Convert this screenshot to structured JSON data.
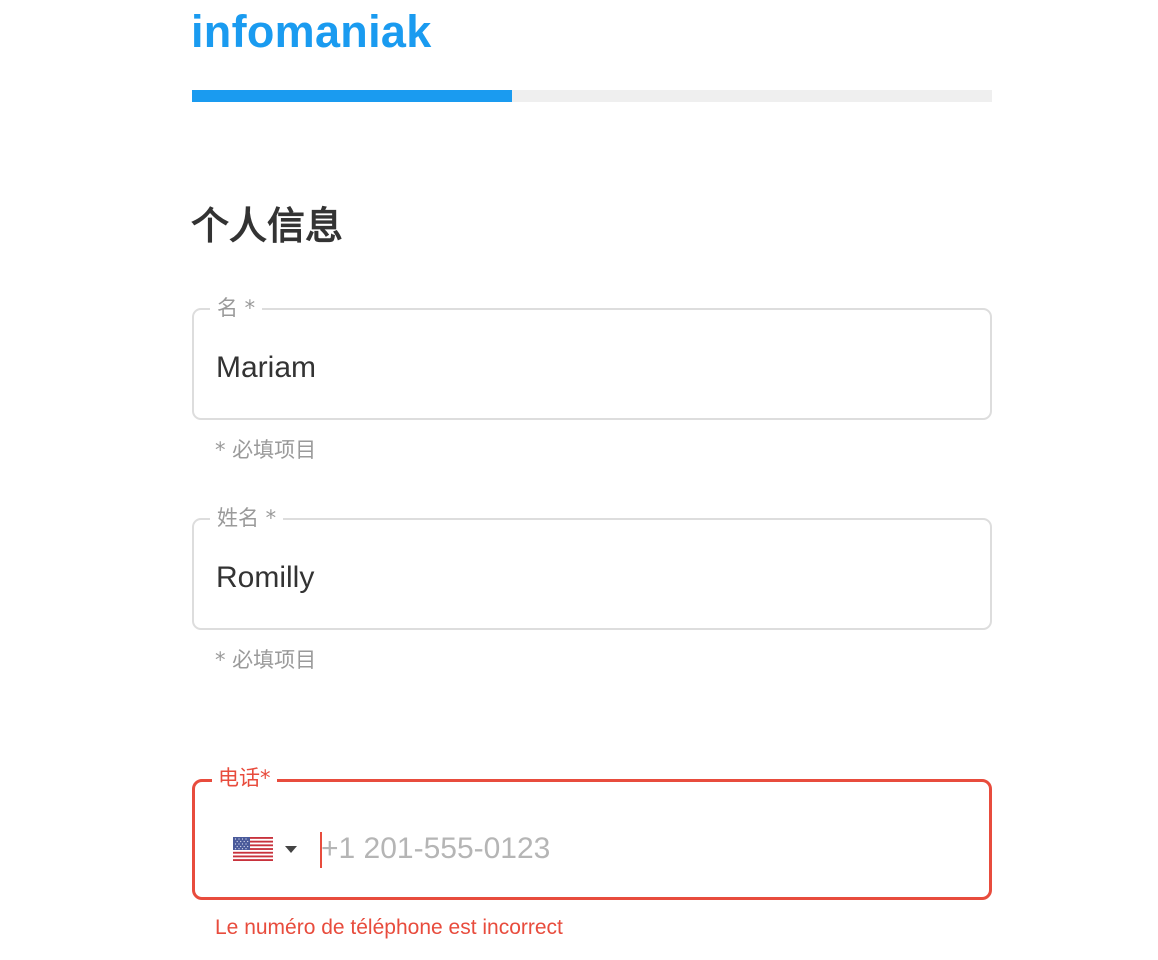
{
  "brand": {
    "logo_text": "infomaniak",
    "color": "#1a9bf0"
  },
  "progress": {
    "fraction": 0.4,
    "fill_color": "#1a9bf0",
    "track_color": "#efefef"
  },
  "section": {
    "title": "个人信息"
  },
  "fields": {
    "first_name": {
      "label": "名 *",
      "value": "Mariam",
      "helper": "* 必填项目"
    },
    "last_name": {
      "label": "姓名 *",
      "value": "Romilly",
      "helper": "* 必填项目"
    },
    "phone": {
      "label": "电话*",
      "country": "us-flag-icon",
      "placeholder": "+1 201-555-0123",
      "value": "",
      "error": "Le numéro de téléphone est incorrect",
      "error_color": "#e84c3d"
    }
  }
}
